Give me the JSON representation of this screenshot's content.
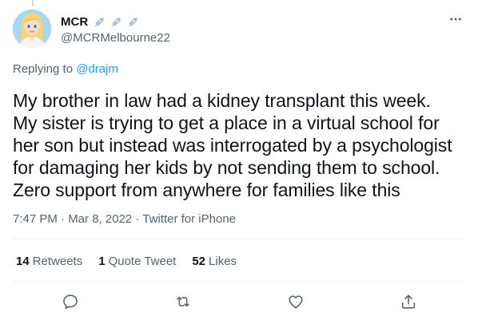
{
  "user": {
    "display_name": "MCR",
    "badges": [
      "syringe-icon",
      "syringe-icon",
      "syringe-icon"
    ],
    "handle": "@MCRMelbourne22"
  },
  "reply": {
    "prefix": "Replying to",
    "mention": "@drajm"
  },
  "tweet": {
    "lines": [
      "My brother in law had a kidney transplant this week.",
      "My sister is trying to get a place in a virtual school for",
      "her son but instead was interrogated by a psychologist",
      "for damaging her kids by not sending them to school.",
      "Zero support from anywhere for families like this"
    ]
  },
  "meta": {
    "text": "7:47 PM · Mar 8, 2022 · Twitter for iPhone"
  },
  "stats": {
    "retweets_count": "14",
    "retweets_label": "Retweets",
    "quotes_count": "1",
    "quotes_label": "Quote Tweet",
    "likes_count": "52",
    "likes_label": "Likes"
  },
  "colors": {
    "link": "#1d9bf0",
    "secondary_text": "#536471",
    "divider": "#eff3f4"
  },
  "icons": {
    "more": "more-icon",
    "reply": "reply-icon",
    "retweet": "retweet-icon",
    "like": "like-icon",
    "share": "share-icon"
  }
}
